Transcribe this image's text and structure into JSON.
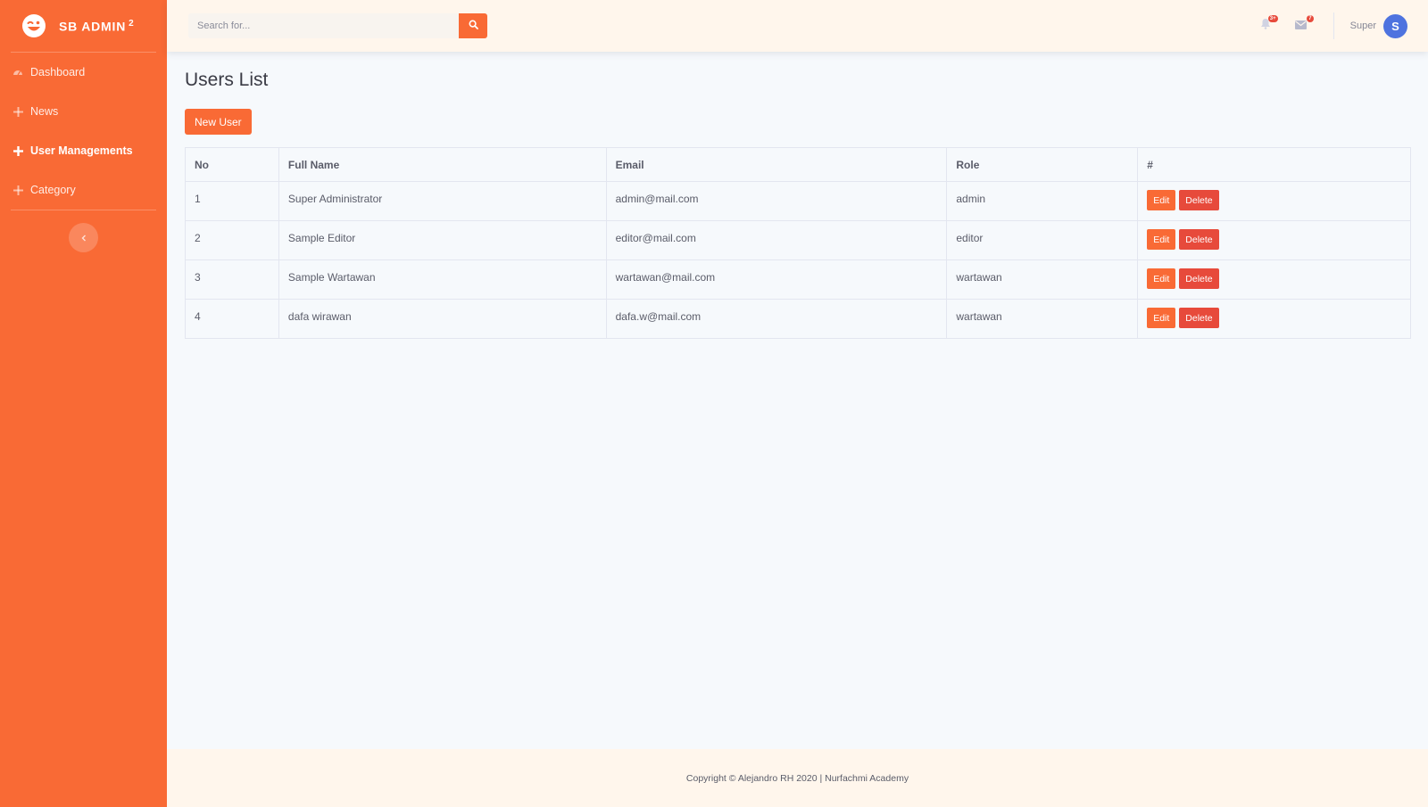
{
  "sidebar": {
    "brand": {
      "name": "SB ADMIN",
      "sup": "2",
      "icon": "laugh-wink-icon"
    },
    "items": [
      {
        "label": "Dashboard",
        "icon": "tachometer-icon",
        "active": false
      },
      {
        "label": "News",
        "icon": "plus-icon",
        "active": false
      },
      {
        "label": "User Managements",
        "icon": "plus-icon",
        "active": true
      },
      {
        "label": "Category",
        "icon": "plus-icon",
        "active": false
      }
    ],
    "toggle_icon": "chevron-left-icon"
  },
  "topbar": {
    "search": {
      "placeholder": "Search for...",
      "button_icon": "search-icon"
    },
    "alerts": {
      "icon": "bell-icon",
      "badge": "3+"
    },
    "messages": {
      "icon": "envelope-icon",
      "badge": "7"
    },
    "user": {
      "name": "Super",
      "avatar_initial": "S"
    }
  },
  "main": {
    "title": "Users List",
    "new_button": "New User",
    "table": {
      "headers": [
        "No",
        "Full Name",
        "Email",
        "Role",
        "#"
      ],
      "rows": [
        {
          "no": "1",
          "name": "Super Administrator",
          "email": "admin@mail.com",
          "role": "admin"
        },
        {
          "no": "2",
          "name": "Sample Editor",
          "email": "editor@mail.com",
          "role": "editor"
        },
        {
          "no": "3",
          "name": "Sample Wartawan",
          "email": "wartawan@mail.com",
          "role": "wartawan"
        },
        {
          "no": "4",
          "name": "dafa wirawan",
          "email": "dafa.w@mail.com",
          "role": "wartawan"
        }
      ],
      "edit_label": "Edit",
      "delete_label": "Delete"
    }
  },
  "footer": {
    "text": "Copyright © Alejandro RH 2020 | Nurfachmi Academy"
  },
  "colors": {
    "primary": "#f96a35",
    "danger": "#e74a3b",
    "avatar": "#4e73df",
    "topbar_bg": "#fff6ec",
    "content_bg": "#f6f9fc"
  }
}
